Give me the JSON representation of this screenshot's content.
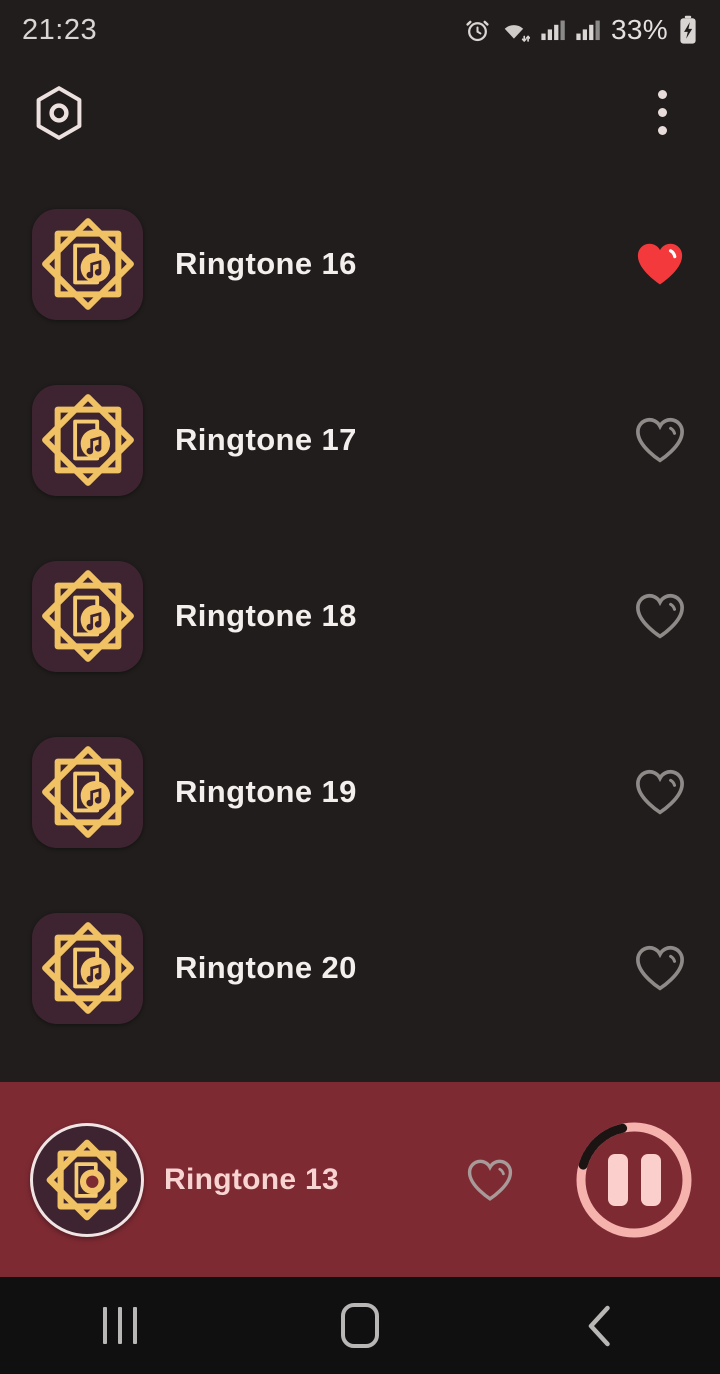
{
  "status_bar": {
    "time": "21:23",
    "battery_percent": "33%",
    "icons": [
      "alarm-icon",
      "wifi-icon",
      "signal-icon",
      "signal-icon",
      "battery-charging-icon"
    ]
  },
  "app_bar": {
    "settings_icon": "hexagon-nut-icon",
    "overflow_icon": "more-vertical-icon"
  },
  "list": {
    "items": [
      {
        "title": "Ringtone 16",
        "favorite": true,
        "thumbnail": "ringtone-star-icon"
      },
      {
        "title": "Ringtone 17",
        "favorite": false,
        "thumbnail": "ringtone-star-icon"
      },
      {
        "title": "Ringtone 18",
        "favorite": false,
        "thumbnail": "ringtone-star-icon"
      },
      {
        "title": "Ringtone 19",
        "favorite": false,
        "thumbnail": "ringtone-star-icon"
      },
      {
        "title": "Ringtone 20",
        "favorite": false,
        "thumbnail": "ringtone-star-icon"
      }
    ]
  },
  "player": {
    "title": "Ringtone 13",
    "favorite": false,
    "state": "playing",
    "control_icon": "pause-icon",
    "progress_percent": 17,
    "artwork": "ringtone-star-icon"
  },
  "nav_bar": {
    "recents_label": "recents-icon",
    "home_label": "home-icon",
    "back_label": "back-icon"
  },
  "colors": {
    "background": "#201d1c",
    "player_bg": "#7e2a33",
    "nav_bg": "#111010",
    "accent_gold": "#f0c060",
    "thumb_bg": "#3d2430",
    "favorite_red": "#f4393c",
    "heart_outline": "#8d8a88",
    "player_text": "#f7d3d2",
    "pause_pink": "#fbcfcb"
  }
}
